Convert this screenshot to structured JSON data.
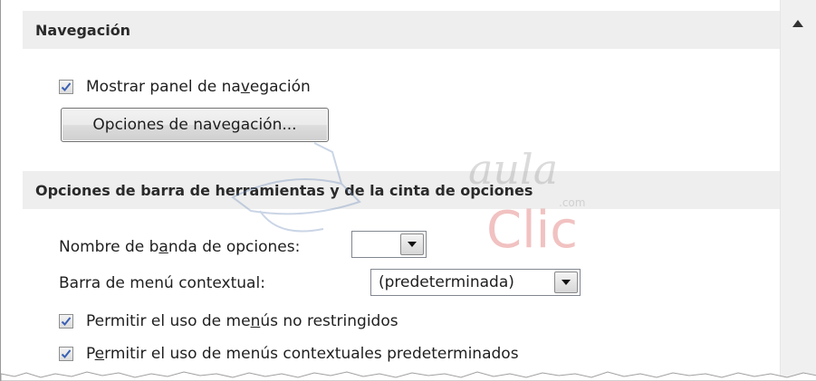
{
  "sections": {
    "navegacion": {
      "title": "Navegación",
      "show_nav_pane": {
        "label_pre": "Mostrar panel de na",
        "label_accel": "v",
        "label_post": "egación",
        "checked": true
      },
      "nav_options_button": "Opciones de navegación..."
    },
    "toolbars": {
      "title": "Opciones de barra de herramientas y de la cinta de opciones",
      "ribbon_name": {
        "label_pre": "Nombre de b",
        "label_accel": "a",
        "label_post": "nda de opciones:",
        "value": ""
      },
      "shortcut_menu_bar": {
        "label": "Barra de menú contextual:",
        "value": "(predeterminada)"
      },
      "allow_full_menus": {
        "label_pre": "Permitir el uso de me",
        "label_accel": "n",
        "label_post": "ús no restringidos",
        "checked": true
      },
      "allow_default_shortcut_menus": {
        "label_pre": "P",
        "label_accel": "e",
        "label_post": "rmitir el uso de menús contextuales predeterminados",
        "checked": true
      }
    }
  },
  "watermark": {
    "brand_top": "aula",
    "brand_bottom": "Clic",
    "domain": ".com"
  },
  "icons": {
    "checkbox": "checkmark-icon",
    "dropdown": "chevron-down-icon",
    "scroll_up": "triangle-up-icon"
  },
  "colors": {
    "header_bg": "#eeeeee",
    "check_blue": "#3a5fb3",
    "watermark_red": "#d9534f"
  }
}
